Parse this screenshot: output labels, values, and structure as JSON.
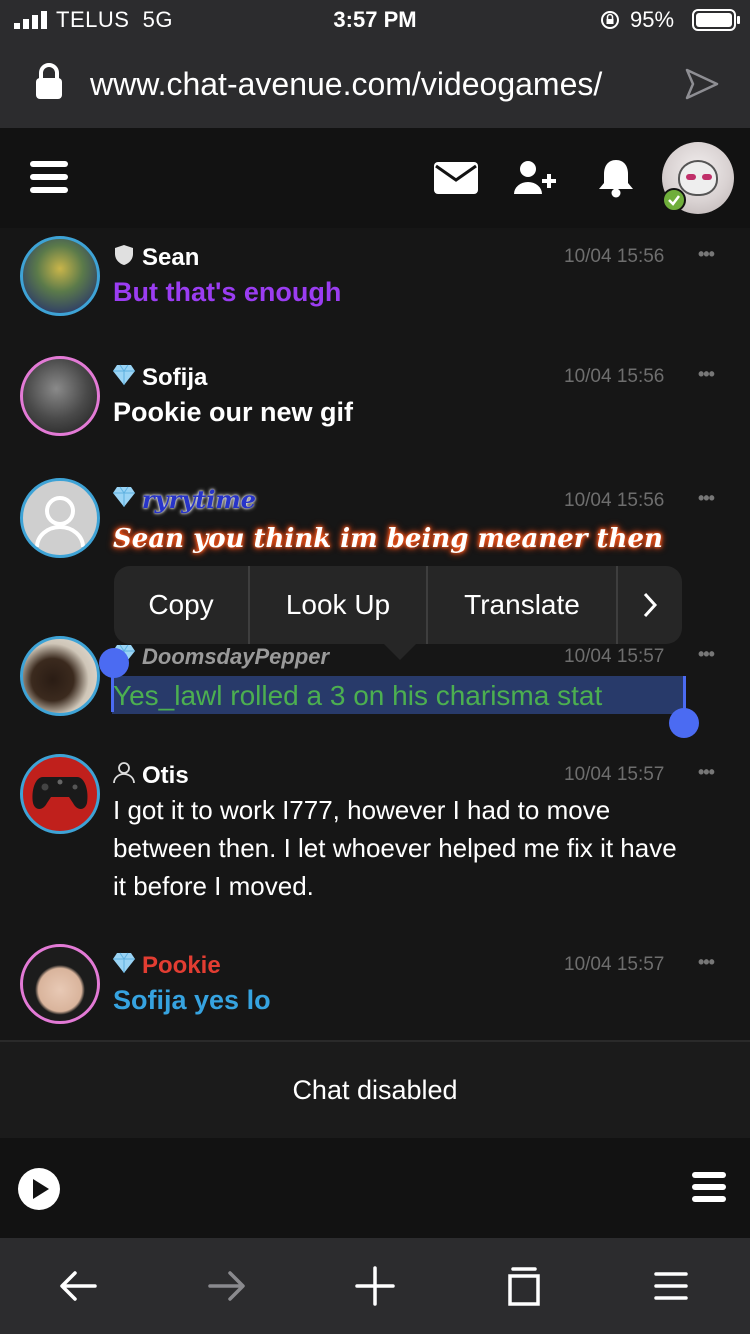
{
  "status_bar": {
    "carrier": "TELUS",
    "network": "5G",
    "time": "3:57 PM",
    "battery_percent": "95%",
    "signal_bars": 4
  },
  "browser": {
    "url": "www.chat-avenue.com/videogames/"
  },
  "header": {
    "icons": [
      "menu-icon",
      "mail-icon",
      "add-user-icon",
      "bell-icon",
      "user-avatar"
    ],
    "online_status_color": "#6fae3b"
  },
  "messages": [
    {
      "name": "Sean",
      "rank_icon": "shield-icon",
      "name_color": "#ffffff",
      "timestamp": "10/04 15:56",
      "text": "But that's enough",
      "text_color": "#9b3df2",
      "avatar_border": "#3ea3d6"
    },
    {
      "name": "Sofija",
      "rank_icon": "diamond-icon",
      "name_color": "#ffffff",
      "timestamp": "10/04 15:56",
      "text": "Pookie our new gif",
      "text_color": "#ffffff",
      "avatar_border": "#e37ad6"
    },
    {
      "name": "ryrytime",
      "rank_icon": "diamond-icon",
      "name_color": "#2734c9",
      "timestamp": "10/04 15:56",
      "text": "Sean you think im being meaner then",
      "text_color": "#ffffff",
      "avatar_border": "#3ea3d6"
    },
    {
      "name": "DoomsdayPepper",
      "rank_icon": "diamond-icon",
      "name_color": "#9a9a9a",
      "timestamp": "10/04 15:57",
      "text": "Yes_lawl rolled a 3 on his charisma stat",
      "text_color": "#4caf50",
      "avatar_border": "#3ea3d6"
    },
    {
      "name": "Otis",
      "rank_icon": "user-icon",
      "name_color": "#ffffff",
      "timestamp": "10/04 15:57",
      "text_lines": [
        "I got it to work I777, however I had to move",
        "between then. I let whoever helped me fix it have",
        "it before I moved."
      ],
      "text_color": "#ffffff",
      "avatar_border": "#3ea3d6"
    },
    {
      "name": "Pookie",
      "rank_icon": "diamond-icon",
      "name_color": "#e23d32",
      "timestamp": "10/04 15:57",
      "text": "Sofija yes lo",
      "text_color": "#36a3e0",
      "avatar_border": "#e37ad6"
    }
  ],
  "context_menu": {
    "items": [
      "Copy",
      "Look Up",
      "Translate"
    ],
    "more_icon": "chevron-right-icon"
  },
  "chat_status": "Chat disabled",
  "footer": {
    "icons": [
      "play-icon",
      "menu-icon"
    ]
  },
  "browser_toolbar": {
    "icons": [
      "back-arrow-icon",
      "forward-arrow-icon",
      "new-tab-icon",
      "tabs-icon",
      "menu-icon"
    ]
  },
  "colors": {
    "background": "#161616",
    "selection": "#4b6bf2",
    "accent_purple": "#9b3df2"
  }
}
